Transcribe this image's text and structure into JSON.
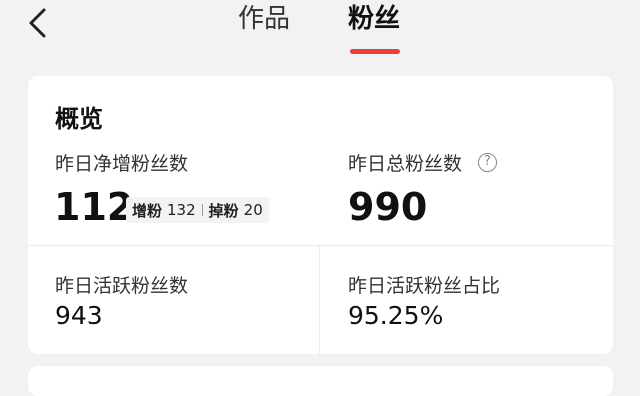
{
  "header": {
    "tabs": [
      {
        "label": "作品",
        "active": false
      },
      {
        "label": "粉丝",
        "active": true
      }
    ],
    "back_icon": "chevron-left-icon",
    "accent_color": "#e8403b"
  },
  "overview": {
    "title": "概览",
    "net_growth": {
      "label": "昨日净增粉丝数",
      "value": "112"
    },
    "breakdown": {
      "gain_label": "增粉",
      "gain_value": "132",
      "loss_label": "掉粉",
      "loss_value": "20"
    },
    "total": {
      "label": "昨日总粉丝数",
      "value": "990",
      "help_icon": "question-circle-icon",
      "help_glyph": "?"
    },
    "active": {
      "label": "昨日活跃粉丝数",
      "value": "943"
    },
    "active_ratio": {
      "label": "昨日活跃粉丝占比",
      "value": "95.25%"
    }
  }
}
